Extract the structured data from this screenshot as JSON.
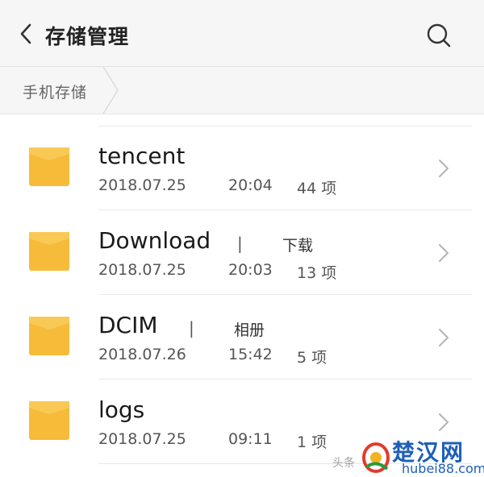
{
  "header": {
    "title": "存储管理",
    "back_icon": "chevron-left-icon",
    "search_icon": "search-icon"
  },
  "breadcrumb": {
    "label": "手机存储"
  },
  "folders": [
    {
      "name": "tencent",
      "alias": "",
      "date": "2018.07.25",
      "time": "20:04",
      "count": "44 项"
    },
    {
      "name": "Download",
      "alias": "下载",
      "date": "2018.07.25",
      "time": "20:03",
      "count": "13 项"
    },
    {
      "name": "DCIM",
      "alias": "相册",
      "date": "2018.07.26",
      "time": "15:42",
      "count": "5 项"
    },
    {
      "name": "logs",
      "alias": "",
      "date": "2018.07.25",
      "time": "09:11",
      "count": "1 项"
    }
  ],
  "colors": {
    "folder": "#f7bb3a",
    "folder_flap": "#f9c955",
    "watermark_blue": "#1d5fb8"
  },
  "watermark": {
    "caption": "头条",
    "brand": "楚汉网",
    "domain": "hubei88.com"
  }
}
